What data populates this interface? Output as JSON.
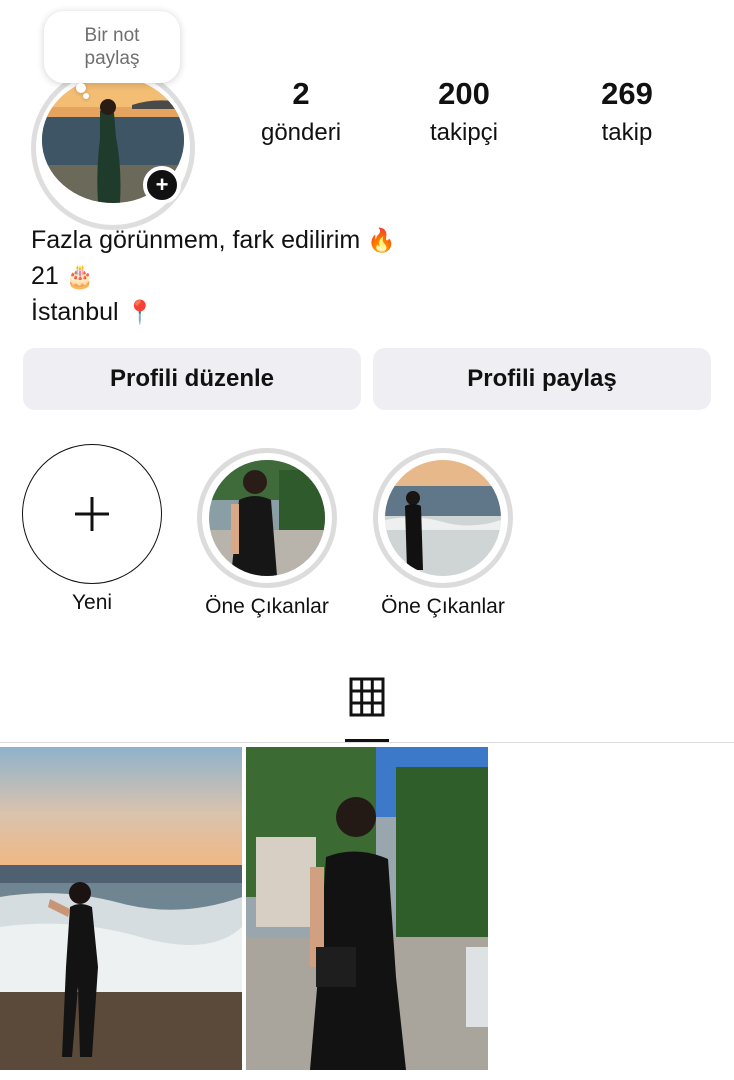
{
  "note": {
    "text": "Bir not paylaş"
  },
  "stats": [
    {
      "value": "2",
      "label": "gönderi"
    },
    {
      "value": "200",
      "label": "takipçi"
    },
    {
      "value": "269",
      "label": "takip"
    }
  ],
  "bio": {
    "line1": "Fazla görünmem, fark edilirim",
    "line1_emoji": "🔥",
    "line2": "21",
    "line2_emoji": "🎂",
    "line3": "İstanbul",
    "line3_emoji": "📍"
  },
  "buttons": {
    "edit_profile": "Profili düzenle",
    "share_profile": "Profili paylaş"
  },
  "highlights": {
    "new_label": "Yeni",
    "items": [
      {
        "label": "Öne Çıkanlar"
      },
      {
        "label": "Öne Çıkanlar"
      }
    ]
  },
  "icons": {
    "add_story": "plus-icon",
    "new_highlight": "plus-icon",
    "posts_tab": "grid-icon"
  },
  "colors": {
    "button_bg": "#efeff3",
    "ring_gray": "#dcdcdc",
    "text": "#111111",
    "note_text": "#6f6f6f"
  }
}
